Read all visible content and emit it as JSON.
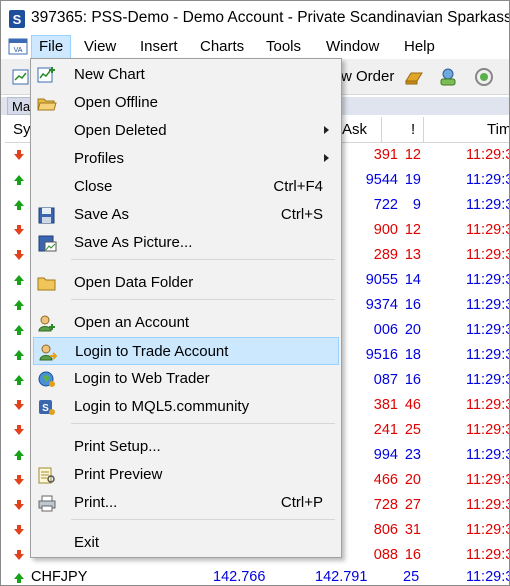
{
  "window": {
    "title": "397365: PSS-Demo - Demo Account - Private Scandinavian Sparkasse"
  },
  "menubar": {
    "items": [
      "File",
      "View",
      "Insert",
      "Charts",
      "Tools",
      "Window",
      "Help"
    ]
  },
  "toolbar": {
    "new_order_label": "w Order"
  },
  "market_watch": {
    "tab_label": "Ma",
    "columns": {
      "symbol": "Sy",
      "ask": "Ask",
      "spread": "!",
      "time": "Tim"
    },
    "rows": [
      {
        "dir": "down",
        "ask": "391",
        "spread": "12",
        "time": "11:29:3",
        "color": "red"
      },
      {
        "dir": "up",
        "ask": "9544",
        "spread": "19",
        "time": "11:29:3",
        "color": "blue"
      },
      {
        "dir": "up",
        "ask": "722",
        "spread": "9",
        "time": "11:29:3",
        "color": "blue"
      },
      {
        "dir": "down",
        "ask": "900",
        "spread": "12",
        "time": "11:29:3",
        "color": "red"
      },
      {
        "dir": "down",
        "ask": "289",
        "spread": "13",
        "time": "11:29:3",
        "color": "red"
      },
      {
        "dir": "up",
        "ask": "9055",
        "spread": "14",
        "time": "11:29:3",
        "color": "blue"
      },
      {
        "dir": "up",
        "ask": "9374",
        "spread": "16",
        "time": "11:29:3",
        "color": "blue"
      },
      {
        "dir": "up",
        "ask": "006",
        "spread": "20",
        "time": "11:29:3",
        "color": "blue"
      },
      {
        "dir": "up",
        "ask": "9516",
        "spread": "18",
        "time": "11:29:3",
        "color": "blue"
      },
      {
        "dir": "up",
        "ask": "087",
        "spread": "16",
        "time": "11:29:3",
        "color": "blue"
      },
      {
        "dir": "down",
        "ask": "381",
        "spread": "46",
        "time": "11:29:3",
        "color": "red"
      },
      {
        "dir": "down",
        "ask": "241",
        "spread": "25",
        "time": "11:29:3",
        "color": "red"
      },
      {
        "dir": "up",
        "ask": "994",
        "spread": "23",
        "time": "11:29:3",
        "color": "blue"
      },
      {
        "dir": "down",
        "ask": "466",
        "spread": "20",
        "time": "11:29:3",
        "color": "red"
      },
      {
        "dir": "down",
        "ask": "728",
        "spread": "27",
        "time": "11:29:3",
        "color": "red"
      },
      {
        "dir": "down",
        "ask": "806",
        "spread": "31",
        "time": "11:29:3",
        "color": "red"
      },
      {
        "dir": "down",
        "ask": "088",
        "spread": "16",
        "time": "11:29:3",
        "color": "red"
      }
    ],
    "last_row": {
      "symbol": "CHFJPY",
      "bid": "142.766",
      "ask": "142.791",
      "spread": "25",
      "time": "11:29:3"
    }
  },
  "file_menu": {
    "items": [
      {
        "name": "new-chart",
        "label": "New Chart",
        "shortcut": "",
        "submenu": false,
        "icon": "new-chart-icon"
      },
      {
        "name": "open-offline",
        "label": "Open Offline",
        "shortcut": "",
        "submenu": false,
        "icon": "open-folder-icon"
      },
      {
        "name": "open-deleted",
        "label": "Open Deleted",
        "shortcut": "",
        "submenu": true,
        "icon": ""
      },
      {
        "name": "profiles",
        "label": "Profiles",
        "shortcut": "",
        "submenu": true,
        "icon": ""
      },
      {
        "name": "close",
        "label": "Close",
        "shortcut": "Ctrl+F4",
        "submenu": false,
        "icon": ""
      },
      {
        "name": "save-as",
        "label": "Save As",
        "shortcut": "Ctrl+S",
        "submenu": false,
        "icon": "floppy-disk-icon"
      },
      {
        "name": "save-as-picture",
        "label": "Save As Picture...",
        "shortcut": "",
        "submenu": false,
        "icon": "save-picture-icon"
      },
      {
        "name": "open-data-folder",
        "label": "Open Data Folder",
        "shortcut": "",
        "submenu": false,
        "icon": "folder-icon"
      },
      {
        "name": "open-account",
        "label": "Open an Account",
        "shortcut": "",
        "submenu": false,
        "icon": "add-user-icon"
      },
      {
        "name": "login-trade-account",
        "label": "Login to Trade Account",
        "shortcut": "",
        "submenu": false,
        "icon": "login-user-icon"
      },
      {
        "name": "login-web-trader",
        "label": "Login to Web Trader",
        "shortcut": "",
        "submenu": false,
        "icon": "globe-icon"
      },
      {
        "name": "login-mql5",
        "label": "Login to MQL5.community",
        "shortcut": "",
        "submenu": false,
        "icon": "mql5-icon"
      },
      {
        "name": "print-setup",
        "label": "Print Setup...",
        "shortcut": "",
        "submenu": false,
        "icon": ""
      },
      {
        "name": "print-preview",
        "label": "Print Preview",
        "shortcut": "",
        "submenu": false,
        "icon": "print-preview-icon"
      },
      {
        "name": "print",
        "label": "Print...",
        "shortcut": "Ctrl+P",
        "submenu": false,
        "icon": "printer-icon"
      },
      {
        "name": "exit",
        "label": "Exit",
        "shortcut": "",
        "submenu": false,
        "icon": ""
      }
    ],
    "highlighted": "Login to Trade Account"
  },
  "colors": {
    "up_arrow": "#1aa11a",
    "down_arrow": "#e2421b",
    "price_red": "#e00000",
    "price_blue": "#0000e0",
    "menu_highlight": "#cce8ff"
  }
}
